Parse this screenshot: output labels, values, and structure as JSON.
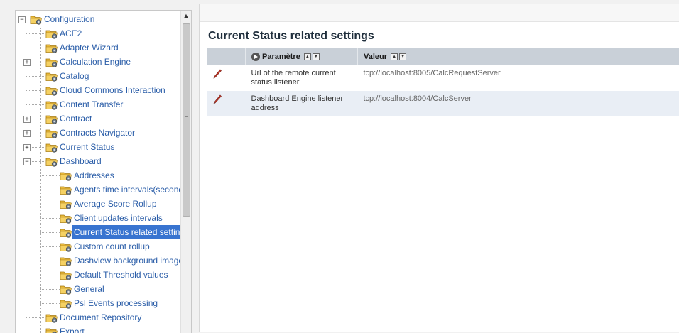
{
  "tree": {
    "nodes": [
      {
        "label": "Configuration",
        "expander": "−"
      },
      {
        "label": "ACE2",
        "expander": ""
      },
      {
        "label": "Adapter Wizard",
        "expander": ""
      },
      {
        "label": "Calculation Engine",
        "expander": "+"
      },
      {
        "label": "Catalog",
        "expander": ""
      },
      {
        "label": "Cloud Commons Interaction",
        "expander": ""
      },
      {
        "label": "Content Transfer",
        "expander": ""
      },
      {
        "label": "Contract",
        "expander": "+"
      },
      {
        "label": "Contracts Navigator",
        "expander": "+"
      },
      {
        "label": "Current Status",
        "expander": "+"
      },
      {
        "label": "Dashboard",
        "expander": "−"
      },
      {
        "label": "Addresses",
        "expander": ""
      },
      {
        "label": "Agents time intervals(seconds",
        "expander": ""
      },
      {
        "label": "Average Score Rollup",
        "expander": ""
      },
      {
        "label": "Client updates intervals",
        "expander": ""
      },
      {
        "label": "Current Status related setting",
        "expander": "",
        "selected": true
      },
      {
        "label": "Custom count rollup",
        "expander": ""
      },
      {
        "label": "Dashview background image",
        "expander": ""
      },
      {
        "label": "Default Threshold values",
        "expander": ""
      },
      {
        "label": "General",
        "expander": ""
      },
      {
        "label": "Psl Events processing",
        "expander": ""
      },
      {
        "label": "Document Repository",
        "expander": ""
      },
      {
        "label": "Export",
        "expander": ""
      }
    ],
    "scroll_up_glyph": "▲"
  },
  "content": {
    "title": "Current Status related settings",
    "columns": {
      "param": "Paramètre",
      "value": "Valeur"
    },
    "sort_glyphs": {
      "asc": "▲",
      "desc": "▼"
    },
    "rows": [
      {
        "param": "Url of the remote current status listener",
        "value": "tcp://localhost:8005/CalcRequestServer"
      },
      {
        "param": "Dashboard Engine listener address",
        "value": "tcp://localhost:8004/CalcServer"
      }
    ]
  },
  "colors": {
    "link": "#2a5da8",
    "selection": "#3874d0",
    "header_bg": "#c9d0d8",
    "alt_row": "#e9eef5",
    "pencil": "#c0392b"
  },
  "icons": [
    "folder-gear-icon",
    "pencil-icon",
    "expand-icon",
    "collapse-icon",
    "sort-asc-icon",
    "sort-desc-icon"
  ]
}
